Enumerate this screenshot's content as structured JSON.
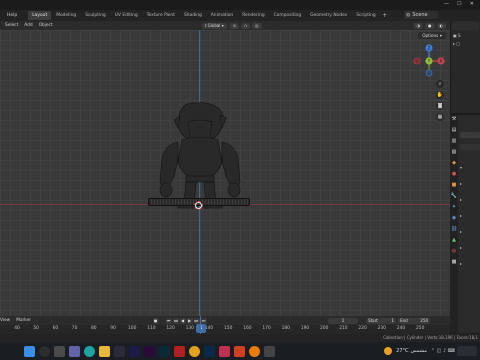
{
  "top_menu": {
    "help": "Help",
    "workspaces": [
      "Layout",
      "Modeling",
      "Sculpting",
      "UV Editing",
      "Texture Paint",
      "Shading",
      "Animation",
      "Rendering",
      "Compositing",
      "Geometry Nodes",
      "Scripting"
    ],
    "add_tab": "+",
    "scene_label": "Scene"
  },
  "header": {
    "select": "Select",
    "add": "Add",
    "object": "Object",
    "transform_orientation": "Global"
  },
  "viewport": {
    "options": "Options",
    "gizmo": {
      "x": "X",
      "y": "Y",
      "z": "Z"
    }
  },
  "timeline": {
    "view": "View",
    "marker": "Marker",
    "current_frame": "1",
    "start_label": "Start",
    "start_value": "1",
    "end_label": "End",
    "end_value": "250",
    "ticks": [
      "40",
      "50",
      "60",
      "70",
      "80",
      "90",
      "100",
      "110",
      "120",
      "130",
      "140",
      "150",
      "160",
      "170",
      "180",
      "190",
      "200",
      "210",
      "220",
      "230",
      "240",
      "250"
    ]
  },
  "status": {
    "text": "Collection | Cylinder | Verts:18,196 | Faces:18,1"
  },
  "taskbar": {
    "weather_temp": "27°C",
    "weather_text": "مشمس"
  },
  "colors": {
    "accent": "#3d6ea8",
    "axis_x": "#c4434f",
    "axis_y": "#6e9e2b",
    "axis_z": "#3f7ed6"
  }
}
